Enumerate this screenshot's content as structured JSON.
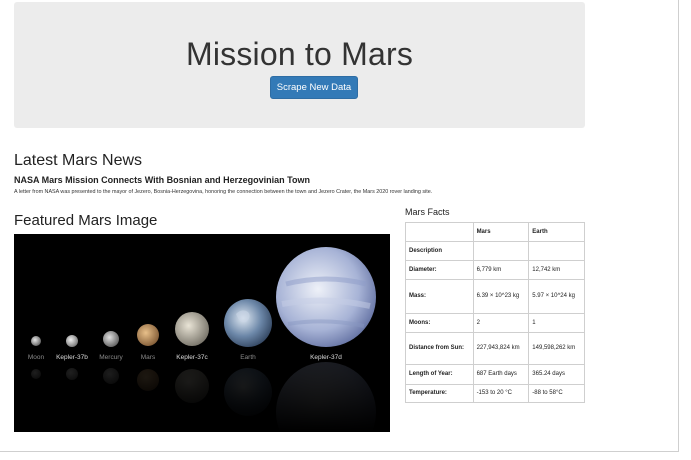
{
  "header": {
    "title": "Mission to Mars",
    "scrape_button": "Scrape New Data"
  },
  "news": {
    "heading": "Latest Mars News",
    "title": "NASA Mars Mission Connects With Bosnian and Herzegovinian Town",
    "paragraph": "A letter from NASA was presented to the mayor of Jezero, Bosnia-Herzegovina, honoring the connection between the town and Jezero Crater, the Mars 2020 rover landing site."
  },
  "featured": {
    "heading": "Featured Mars Image",
    "planet_labels": [
      "Moon",
      "Kepler-37b",
      "Mercury",
      "Mars",
      "Kepler-37c",
      "Earth",
      "Kepler-37d"
    ]
  },
  "facts": {
    "heading": "Mars Facts",
    "columns": [
      "",
      "Mars",
      "Earth"
    ],
    "rows": [
      {
        "label": "Description",
        "mars": "",
        "earth": ""
      },
      {
        "label": "Diameter:",
        "mars": "6,779 km",
        "earth": "12,742 km"
      },
      {
        "label": "Mass:",
        "mars": "6.39 × 10^23 kg",
        "earth": "5.97 × 10^24 kg"
      },
      {
        "label": "Moons:",
        "mars": "2",
        "earth": "1"
      },
      {
        "label": "Distance from Sun:",
        "mars": "227,943,824 km",
        "earth": "149,598,262 km"
      },
      {
        "label": "Length of Year:",
        "mars": "687 Earth days",
        "earth": "365.24 days"
      },
      {
        "label": "Temperature:",
        "mars": "-153 to 20 °C",
        "earth": "-88 to 58°C"
      }
    ]
  },
  "colors": {
    "jumbotron_bg": "#ececec",
    "button_bg": "#337ab7"
  }
}
